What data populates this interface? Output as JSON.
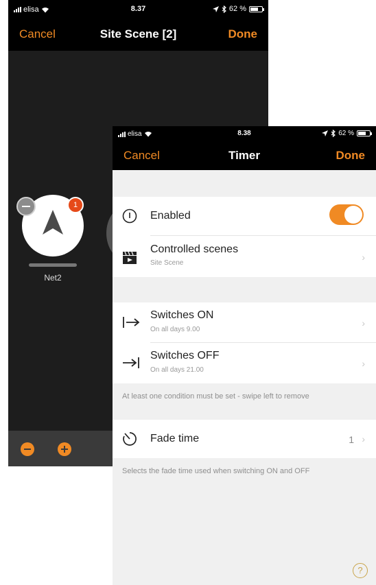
{
  "back_screen": {
    "status": {
      "carrier": "elisa",
      "time": "8.37",
      "battery": "62 %"
    },
    "nav": {
      "cancel": "Cancel",
      "title": "Site Scene [2]",
      "done": "Done"
    },
    "device": {
      "badge_count": "1",
      "label": "Net2"
    }
  },
  "front_screen": {
    "status": {
      "carrier": "elisa",
      "time": "8.38",
      "battery": "62 %"
    },
    "nav": {
      "cancel": "Cancel",
      "title": "Timer",
      "done": "Done"
    },
    "enabled": {
      "label": "Enabled",
      "on": true
    },
    "controlled_scenes": {
      "label": "Controlled scenes",
      "value": "Site Scene"
    },
    "switches_on": {
      "label": "Switches ON",
      "value": "On all days  9.00"
    },
    "switches_off": {
      "label": "Switches OFF",
      "value": "On all days  21.00"
    },
    "conditions_note": "At least one condition must be set - swipe left to remove",
    "fade_time": {
      "label": "Fade time",
      "value": "1"
    },
    "fade_note": "Selects the fade time used when switching ON and OFF",
    "help": "?"
  },
  "colors": {
    "accent": "#f08a24",
    "badge": "#e64a19",
    "nav_bg": "#000000"
  }
}
